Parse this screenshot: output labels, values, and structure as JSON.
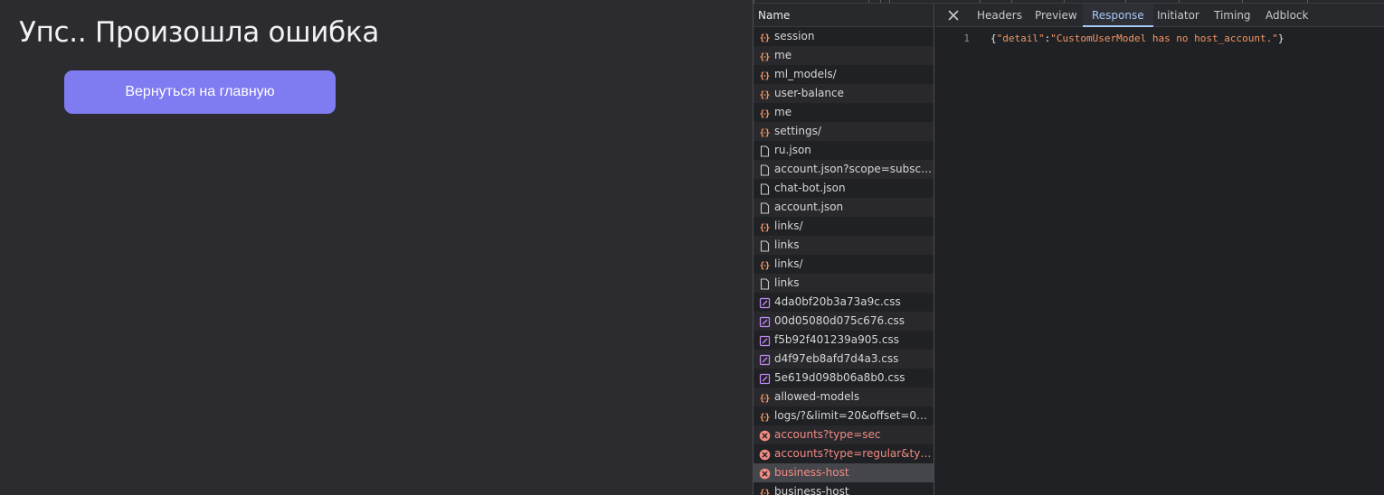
{
  "page": {
    "title": "Упс.. Произошла ошибка",
    "home_button_label": "Вернуться на главную",
    "accent_color": "#7f7cf2"
  },
  "devtools": {
    "name_column_header": "Name",
    "requests": [
      {
        "name": "session",
        "icon": "json-braces-icon",
        "status": "ok"
      },
      {
        "name": "me",
        "icon": "json-braces-icon",
        "status": "ok"
      },
      {
        "name": "ml_models/",
        "icon": "json-braces-icon",
        "status": "ok"
      },
      {
        "name": "user-balance",
        "icon": "json-braces-icon",
        "status": "ok"
      },
      {
        "name": "me",
        "icon": "json-braces-icon",
        "status": "ok"
      },
      {
        "name": "settings/",
        "icon": "json-braces-icon",
        "status": "ok"
      },
      {
        "name": "ru.json",
        "icon": "document-icon",
        "status": "ok"
      },
      {
        "name": "account.json?scope=subscribe",
        "icon": "document-icon",
        "status": "ok"
      },
      {
        "name": "chat-bot.json",
        "icon": "document-icon",
        "status": "ok"
      },
      {
        "name": "account.json",
        "icon": "document-icon",
        "status": "ok"
      },
      {
        "name": "links/",
        "icon": "json-braces-icon",
        "status": "ok"
      },
      {
        "name": "links",
        "icon": "document-icon",
        "status": "ok"
      },
      {
        "name": "links/",
        "icon": "json-braces-icon",
        "status": "ok"
      },
      {
        "name": "links",
        "icon": "document-icon",
        "status": "ok"
      },
      {
        "name": "4da0bf20b3a73a9c.css",
        "icon": "stylesheet-icon",
        "status": "ok"
      },
      {
        "name": "00d05080d075c676.css",
        "icon": "stylesheet-icon",
        "status": "ok"
      },
      {
        "name": "f5b92f401239a905.css",
        "icon": "stylesheet-icon",
        "status": "ok"
      },
      {
        "name": "d4f97eb8afd7d4a3.css",
        "icon": "stylesheet-icon",
        "status": "ok"
      },
      {
        "name": "5e619d098b06a8b0.css",
        "icon": "stylesheet-icon",
        "status": "ok"
      },
      {
        "name": "allowed-models",
        "icon": "json-braces-icon",
        "status": "ok"
      },
      {
        "name": "logs/?&limit=20&offset=0&lo...",
        "icon": "json-braces-icon",
        "status": "ok"
      },
      {
        "name": "accounts?type=sec",
        "icon": "error-icon",
        "status": "error"
      },
      {
        "name": "accounts?type=regular&type...",
        "icon": "error-icon",
        "status": "error"
      },
      {
        "name": "business-host",
        "icon": "error-icon",
        "status": "error",
        "selected": true
      },
      {
        "name": "business-host",
        "icon": "json-braces-icon",
        "status": "ok"
      }
    ],
    "tabs": [
      {
        "label": "Headers",
        "active": false
      },
      {
        "label": "Preview",
        "active": false
      },
      {
        "label": "Response",
        "active": true
      },
      {
        "label": "Initiator",
        "active": false
      },
      {
        "label": "Timing",
        "active": false
      },
      {
        "label": "Adblock",
        "active": false
      }
    ],
    "response": {
      "line_number": "1",
      "open_brace": "{",
      "key": "\"detail\"",
      "colon": ":",
      "value": "\"CustomUserModel has no host_account.\"",
      "close_brace": "}"
    },
    "colors": {
      "json_icon": "#f29766",
      "stylesheet_icon": "#c58af9",
      "error": "#f28b82",
      "active_tab": "#a8c7fa"
    }
  }
}
